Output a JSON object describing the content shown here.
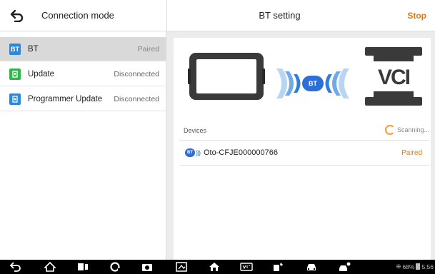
{
  "header": {
    "back_icon": "back-arrow-icon",
    "title": "Connection mode",
    "center_title": "BT setting",
    "stop_label": "Stop",
    "accent": "#e07a10"
  },
  "sidebar": {
    "items": [
      {
        "icon": "bt-icon",
        "icon_text": "BT",
        "label": "BT",
        "status": "Paired",
        "active": true,
        "icon_color": "#2c88d8"
      },
      {
        "icon": "update-icon",
        "label": "Update",
        "status": "Disconnected",
        "active": false,
        "icon_color": "#2cb84a"
      },
      {
        "icon": "programmer-icon",
        "label": "Programmer Update",
        "status": "Disconnected",
        "active": false,
        "icon_color": "#2c88d8"
      }
    ]
  },
  "panel": {
    "bt_badge": "BT",
    "vci_logo": "VCI",
    "devices_label": "Devices",
    "scanning_label": "Scanning...",
    "devices": [
      {
        "name": "Oto-CFJE000000766",
        "status": "Paired"
      }
    ]
  },
  "navbar": {
    "icons": [
      "back-icon",
      "home-icon",
      "recent-apps-icon",
      "browser-icon",
      "camera-icon",
      "screenshot-icon",
      "house-icon",
      "vci-icon",
      "service-icon",
      "car-icon",
      "remote-icon"
    ],
    "battery": "68%",
    "time": "5:56"
  }
}
